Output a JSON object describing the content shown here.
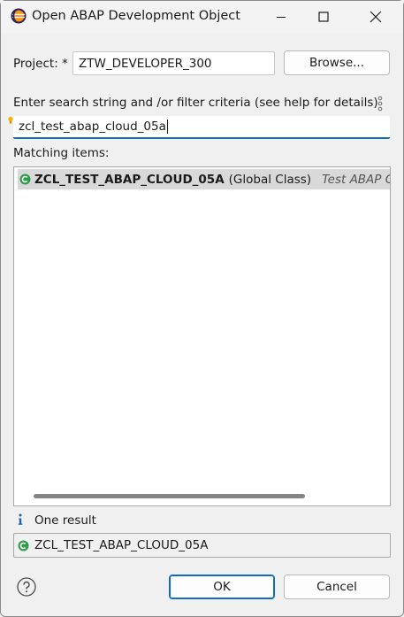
{
  "window": {
    "title": "Open ABAP Development Object"
  },
  "project": {
    "label": "Project: *",
    "value": "ZTW_DEVELOPER_300",
    "browse_label": "Browse..."
  },
  "search": {
    "instruction": "Enter search string and /or filter criteria (see help for details)",
    "value": "zcl_test_abap_cloud_05a"
  },
  "matching": {
    "label": "Matching items:",
    "items": [
      {
        "name": "ZCL_TEST_ABAP_CLOUD_05A",
        "type": "(Global Class)",
        "description": "Test ABAP Clo"
      }
    ]
  },
  "status": {
    "text": "One result"
  },
  "selected": {
    "value": "ZCL_TEST_ABAP_CLOUD_05A"
  },
  "buttons": {
    "ok": "OK",
    "cancel": "Cancel"
  },
  "colors": {
    "accent": "#0f6cbd",
    "class_icon": "#2e9c4a",
    "selection_bg": "#d9d9d9",
    "info_icon": "#1f5fb4"
  },
  "icons": {
    "app": "eclipse-icon",
    "minimize": "minimize-icon",
    "maximize": "maximize-icon",
    "close": "close-icon",
    "menu": "vertical-dots-icon",
    "hint": "content-assist-lightbulb-icon",
    "class": "class-icon",
    "info": "info-icon",
    "help": "help-icon"
  }
}
